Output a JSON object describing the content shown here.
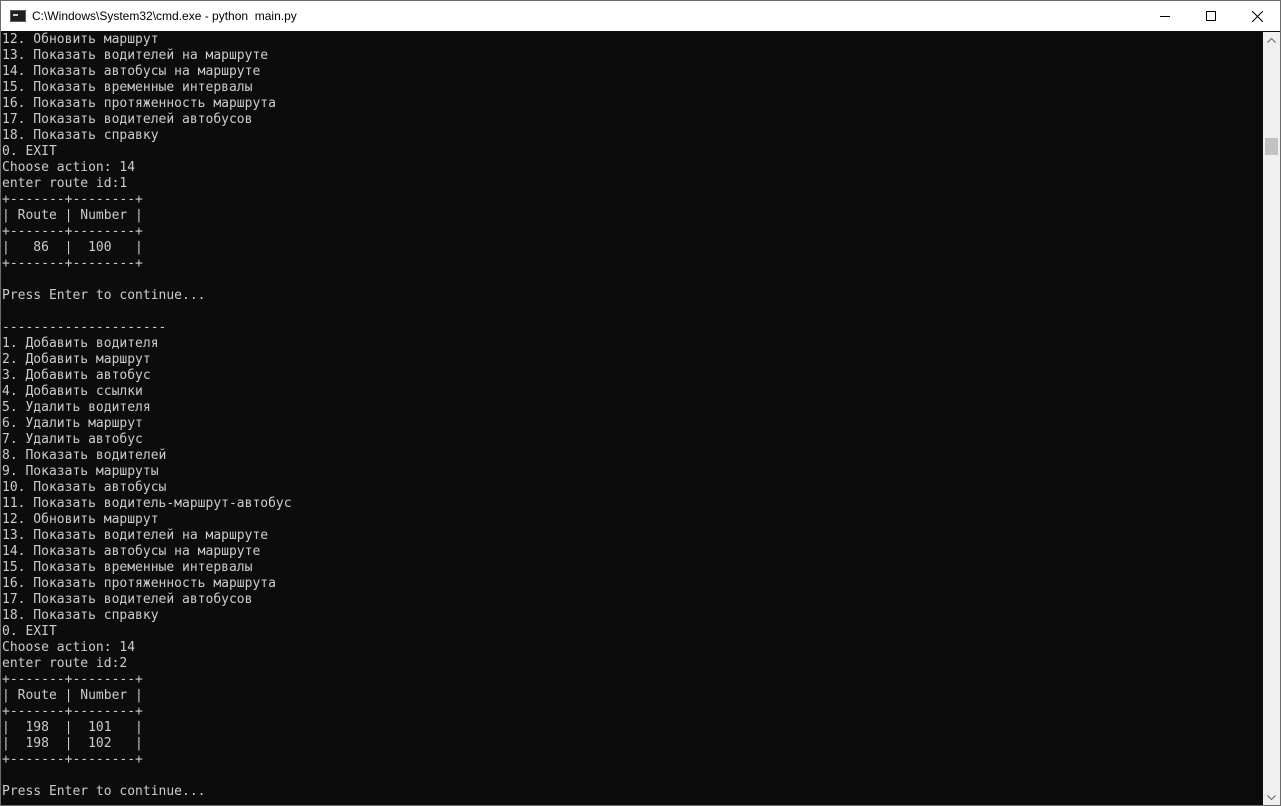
{
  "window": {
    "title": "C:\\Windows\\System32\\cmd.exe - python  main.py",
    "icon": "cmd-icon",
    "minimize_icon": "minimize-icon",
    "maximize_icon": "maximize-icon",
    "close_icon": "close-icon"
  },
  "console": {
    "lines": [
      "12. Обновить маршрут",
      "13. Показать водителей на маршруте",
      "14. Показать автобусы на маршруте",
      "15. Показать временные интервалы",
      "16. Показать протяженность маршрута",
      "17. Показать водителей автобусов",
      "18. Показать справку",
      "0. EXIT",
      "Choose action: 14",
      "enter route id:1",
      "+-------+--------+",
      "| Route | Number |",
      "+-------+--------+",
      "|   86  |  100   |",
      "+-------+--------+",
      "",
      "Press Enter to continue...",
      "",
      "---------------------",
      "1. Добавить водителя",
      "2. Добавить маршрут",
      "3. Добавить автобус",
      "4. Добавить ссылки",
      "5. Удалить водителя",
      "6. Удалить маршрут",
      "7. Удалить автобус",
      "8. Показать водителей",
      "9. Показать маршруты",
      "10. Показать автобусы",
      "11. Показать водитель-маршрут-автобус",
      "12. Обновить маршрут",
      "13. Показать водителей на маршруте",
      "14. Показать автобусы на маршруте",
      "15. Показать временные интервалы",
      "16. Показать протяженность маршрута",
      "17. Показать водителей автобусов",
      "18. Показать справку",
      "0. EXIT",
      "Choose action: 14",
      "enter route id:2",
      "+-------+--------+",
      "| Route | Number |",
      "+-------+--------+",
      "|  198  |  101   |",
      "|  198  |  102   |",
      "+-------+--------+",
      "",
      "Press Enter to continue..."
    ]
  },
  "colors": {
    "console_bg": "#0c0c0c",
    "console_text": "#cccccc",
    "titlebar_bg": "#ffffff",
    "scrollbar_bg": "#f0f0f0",
    "scroll_thumb": "#c2c2c2"
  }
}
